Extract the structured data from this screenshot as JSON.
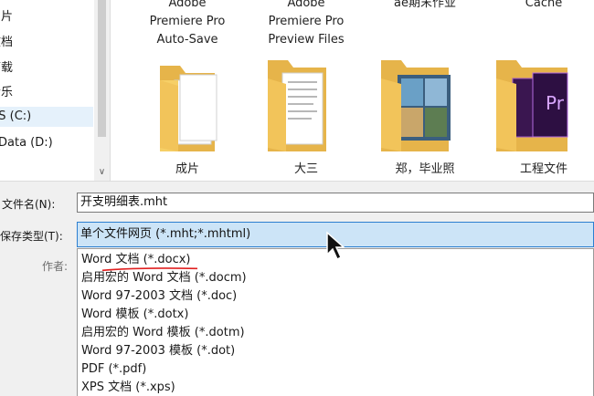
{
  "nav": {
    "items": [
      {
        "label": "图片"
      },
      {
        "label": "文档"
      },
      {
        "label": "下载"
      },
      {
        "label": "音乐"
      },
      {
        "label": "OS (C:)",
        "selected": true
      },
      {
        "label": "Data (D:)"
      }
    ],
    "scroll_icon": "chevron-down-icon"
  },
  "content": {
    "top_labels": [
      [
        "Adobe",
        "Premiere Pro",
        "Auto-Save"
      ],
      [
        "Adobe",
        "Premiere Pro",
        "Preview Files"
      ],
      [
        "ae期末作业"
      ],
      [
        "Cache"
      ]
    ],
    "folders": [
      {
        "label": "成片",
        "icon": "folder-documents-icon"
      },
      {
        "label": "大三",
        "icon": "folder-documents-icon"
      },
      {
        "label": "郑，毕业照",
        "icon": "folder-photos-icon"
      },
      {
        "label": "工程文件",
        "icon": "folder-purple-icon"
      }
    ]
  },
  "form": {
    "filename_label": "文件名(N):",
    "filename_value": "开支明细表.mht",
    "filetype_label": "保存类型(T):",
    "filetype_value": "单个文件网页 (*.mht;*.mhtml)",
    "author_label": "作者:",
    "options": [
      "Word 文档 (*.docx)",
      "启用宏的 Word 文档 (*.docm)",
      "Word 97-2003 文档 (*.doc)",
      "Word 模板 (*.dotx)",
      "启用宏的 Word 模板 (*.dotm)",
      "Word 97-2003 模板 (*.dot)",
      "PDF (*.pdf)",
      "XPS 文档 (*.xps)"
    ]
  },
  "colors": {
    "selection": "#cce4f7",
    "selection_border": "#2c7fd0",
    "annotation": "#e02020",
    "folder": "#f2c45a"
  }
}
